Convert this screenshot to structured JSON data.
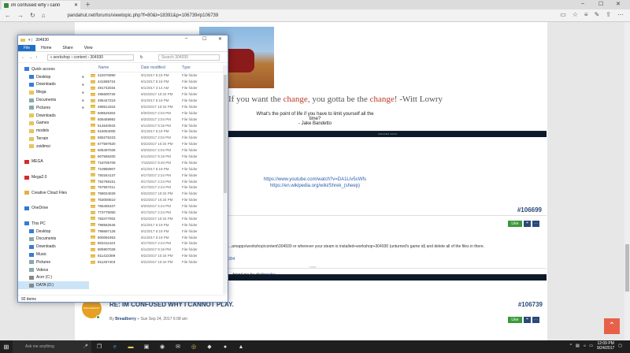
{
  "browser": {
    "tab_title": "im confused why i cann",
    "url": "pandahut.net/forums/viewtopic.php?f=80&t=18391&p=106739#p106739"
  },
  "page": {
    "quote_main_pre": "If you want the ",
    "quote_main_word1": "change",
    "quote_main_mid": ", you gotta be the ",
    "quote_main_word2": "change",
    "quote_main_post": "! -Witt Lowry",
    "quote_sub": "What's the point of life if you have to limit yourself all the time?",
    "quote_sub_author": "- Jake Bandetto",
    "link1": "https://www.youtube.com/watch?v=DA1LIv5cWfs",
    "link2": "https://en.wikipedia.org/wiki/Shrek_(sheep)",
    "bar1_text": "SPEAKER SHOW",
    "post1": {
      "number": "#106699",
      "like": "Like",
      "body": "...amapps\\workshop\\content\\304930 or wherever your steam is installed+workshop+304930 (unturned's game id) and delete all of the files in there.",
      "link": "304",
      "sig_pre": "... friend me by clicking ",
      "sig_link": "this"
    },
    "post2": {
      "title": "RE: IM CONFUSED WHY I CANNOT PLAY.",
      "number": "#106739",
      "by": "By ",
      "author": "Breadberry",
      "date": " » Sun Sep 24, 2017 6:08 am",
      "like": "Like",
      "avatar_text": "BREADBERRY"
    }
  },
  "explorer": {
    "title": "304930",
    "ribbon": [
      "File",
      "Home",
      "Share",
      "View"
    ],
    "path": "« workshop › content › 304930",
    "search_placeholder": "Search 304930",
    "columns": [
      "Name",
      "Date modified",
      "Type"
    ],
    "nav": [
      {
        "label": "Quick access",
        "icon": "star",
        "sub": false,
        "color": "#3a7bd5"
      },
      {
        "label": "Desktop",
        "icon": "desktop",
        "sub": true,
        "pin": true,
        "color": "#3a7bd5"
      },
      {
        "label": "Downloads",
        "icon": "download",
        "sub": true,
        "pin": true,
        "color": "#3a7bd5"
      },
      {
        "label": "Mega",
        "icon": "folder",
        "sub": true,
        "pin": true,
        "color": "#e8c45a"
      },
      {
        "label": "Documents",
        "icon": "documents",
        "sub": true,
        "pin": true,
        "color": "#8aa"
      },
      {
        "label": "Pictures",
        "icon": "pictures",
        "sub": true,
        "pin": true,
        "color": "#8aa"
      },
      {
        "label": "Downloads",
        "icon": "folder",
        "sub": true,
        "color": "#e8c45a"
      },
      {
        "label": "Games",
        "icon": "folder",
        "sub": true,
        "color": "#e8c45a"
      },
      {
        "label": "models",
        "icon": "folder",
        "sub": true,
        "color": "#e8c45a"
      },
      {
        "label": "Terrain",
        "icon": "folder",
        "sub": true,
        "color": "#e8c45a"
      },
      {
        "label": "zsidimsi",
        "icon": "folder",
        "sub": true,
        "color": "#e8c45a"
      },
      {
        "label": "",
        "icon": "none",
        "sub": false,
        "color": "transparent"
      },
      {
        "label": "MEGA",
        "icon": "mega",
        "sub": false,
        "color": "#d9272e"
      },
      {
        "label": "",
        "icon": "none",
        "sub": false,
        "color": "transparent"
      },
      {
        "label": "Mega2.0",
        "icon": "mega",
        "sub": false,
        "color": "#d9272e"
      },
      {
        "label": "",
        "icon": "none",
        "sub": false,
        "color": "transparent"
      },
      {
        "label": "Creative Cloud Files",
        "icon": "cloud",
        "sub": false,
        "color": "#e8b040"
      },
      {
        "label": "",
        "icon": "none",
        "sub": false,
        "color": "transparent"
      },
      {
        "label": "OneDrive",
        "icon": "onedrive",
        "sub": false,
        "color": "#2a7bd5"
      },
      {
        "label": "",
        "icon": "none",
        "sub": false,
        "color": "transparent"
      },
      {
        "label": "This PC",
        "icon": "pc",
        "sub": false,
        "color": "#3a7bd5"
      },
      {
        "label": "Desktop",
        "icon": "desktop",
        "sub": true,
        "color": "#3a7bd5"
      },
      {
        "label": "Documents",
        "icon": "documents",
        "sub": true,
        "color": "#8aa"
      },
      {
        "label": "Downloads",
        "icon": "download",
        "sub": true,
        "color": "#3a7bd5"
      },
      {
        "label": "Music",
        "icon": "music",
        "sub": true,
        "color": "#3a7bd5"
      },
      {
        "label": "Pictures",
        "icon": "pictures",
        "sub": true,
        "color": "#8aa"
      },
      {
        "label": "Videos",
        "icon": "videos",
        "sub": true,
        "color": "#8aa"
      },
      {
        "label": "Acer (C:)",
        "icon": "drive",
        "sub": true,
        "color": "#888"
      },
      {
        "label": "DATA (D:)",
        "icon": "drive",
        "sub": true,
        "sel": true,
        "color": "#888"
      },
      {
        "label": "",
        "icon": "none",
        "sub": false,
        "color": "transparent"
      },
      {
        "label": "Network",
        "icon": "network",
        "sub": false,
        "color": "#3a7bd5"
      }
    ],
    "files": [
      [
        "422070990",
        "9/1/2017 5:19 PM",
        "File folder"
      ],
      [
        "441585724",
        "9/1/2017 5:19 PM",
        "File folder"
      ],
      [
        "491742034",
        "8/1/2017 2:14 AM",
        "File folder"
      ],
      [
        "495600726",
        "9/22/2017 10:34 PM",
        "File folder"
      ],
      [
        "495447219",
        "9/1/2017 5:19 PM",
        "File folder"
      ],
      [
        "498514316",
        "9/22/2017 10:34 PM",
        "File folder"
      ],
      [
        "508526304",
        "9/20/2017 2:04 PM",
        "File folder"
      ],
      [
        "508459982",
        "9/20/2017 2:04 PM",
        "File folder"
      ],
      [
        "514640943",
        "6/14/2017 9:16 PM",
        "File folder"
      ],
      [
        "515054005",
        "9/1/2017 5:19 PM",
        "File folder"
      ],
      [
        "555275223",
        "9/20/2017 2:04 PM",
        "File folder"
      ],
      [
        "677597820",
        "9/22/2017 10:34 PM",
        "File folder"
      ],
      [
        "605497028",
        "9/20/2017 2:04 PM",
        "File folder"
      ],
      [
        "607565200",
        "6/14/2017 9:16 PM",
        "File folder"
      ],
      [
        "718705709",
        "7/15/2017 9:40 PM",
        "File folder"
      ],
      [
        "710950907",
        "9/1/2017 5:19 PM",
        "File folder"
      ],
      [
        "750344137",
        "9/17/2017 2:24 PM",
        "File folder"
      ],
      [
        "752768151",
        "9/17/2017 2:24 PM",
        "File folder"
      ],
      [
        "757567211",
        "9/17/2017 2:24 PM",
        "File folder"
      ],
      [
        "758024029",
        "9/22/2017 10:34 PM",
        "File folder"
      ],
      [
        "763000510",
        "9/22/2017 10:34 PM",
        "File folder"
      ],
      [
        "766455107",
        "9/20/2017 2:24 PM",
        "File folder"
      ],
      [
        "773775050",
        "9/17/2017 2:24 PM",
        "File folder"
      ],
      [
        "783477002",
        "9/22/2017 10:34 PM",
        "File folder"
      ],
      [
        "798562545",
        "9/1/2017 5:19 PM",
        "File folder"
      ],
      [
        "798697128",
        "9/1/2017 5:19 PM",
        "File folder"
      ],
      [
        "800091953",
        "9/1/2017 5:19 PM",
        "File folder"
      ],
      [
        "803411443",
        "9/17/2017 2:24 PM",
        "File folder"
      ],
      [
        "805907028",
        "6/14/2017 9:16 PM",
        "File folder"
      ],
      [
        "811422389",
        "9/22/2017 10:34 PM",
        "File folder"
      ],
      [
        "811267403",
        "9/22/2017 10:34 PM",
        "File folder"
      ]
    ],
    "status": "92 items"
  },
  "taskbar": {
    "ask": "Ask me anything",
    "time": "12:09 PM",
    "date": "9/24/2017"
  }
}
